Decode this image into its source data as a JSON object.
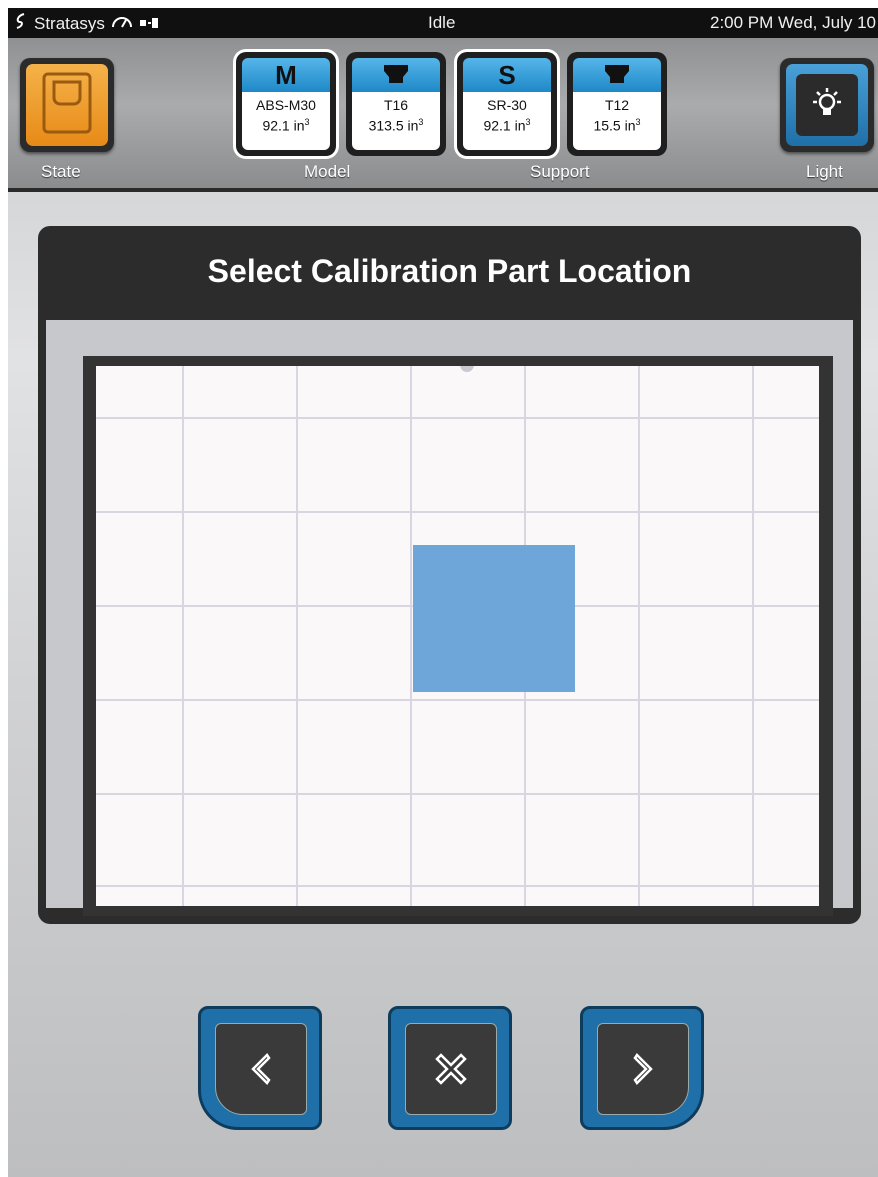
{
  "status_bar": {
    "brand": "Stratasys",
    "status": "Idle",
    "datetime": "2:00 PM Wed, July 10"
  },
  "toolbar": {
    "state_label": "State",
    "model_label": "Model",
    "support_label": "Support",
    "light_label": "Light",
    "materials": [
      {
        "cap": "M",
        "line1": "ABS-M30",
        "amount": "92.1 in",
        "unit_sup": "3"
      },
      {
        "cap": "",
        "line1": "T16",
        "amount": "313.5 in",
        "unit_sup": "3"
      },
      {
        "cap": "S",
        "line1": "SR-30",
        "amount": "92.1 in",
        "unit_sup": "3"
      },
      {
        "cap": "",
        "line1": "T12",
        "amount": "15.5 in",
        "unit_sup": "3"
      }
    ]
  },
  "dialog": {
    "title": "Select Calibration Part Location"
  },
  "colors": {
    "accent_blue": "#1f6fa8",
    "state_orange": "#e78a17",
    "calibration_part": "#6ea6d9"
  },
  "icons": {
    "prev": "chevron-left-icon",
    "cancel": "close-icon",
    "next": "chevron-right-icon",
    "light": "lightbulb-icon"
  }
}
